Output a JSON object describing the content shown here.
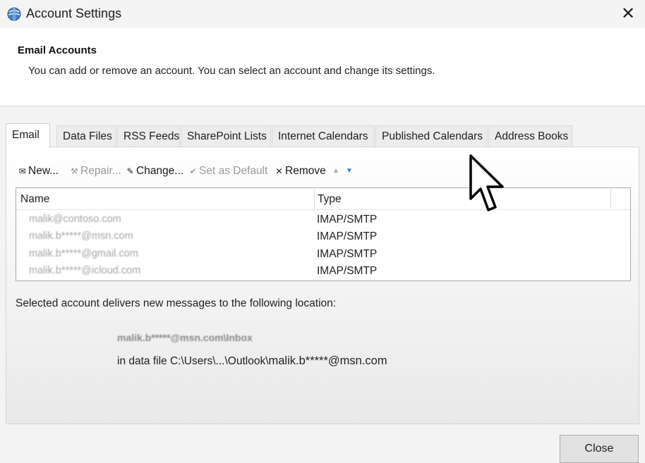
{
  "window": {
    "title": "Account Settings",
    "close_glyph": "✕"
  },
  "header": {
    "title": "Email Accounts",
    "description": "You can add or remove an account. You can select an account and change its settings."
  },
  "tabs": [
    {
      "label": "Email",
      "active": true
    },
    {
      "label": "Data Files"
    },
    {
      "label": "RSS Feeds"
    },
    {
      "label": "SharePoint Lists"
    },
    {
      "label": "Internet Calendars"
    },
    {
      "label": "Published Calendars"
    },
    {
      "label": "Address Books"
    }
  ],
  "toolbar": {
    "new_label": "New...",
    "repair_label": "Repair...",
    "change_label": "Change...",
    "set_default_label": "Set as Default",
    "remove_label": "Remove",
    "remove_glyph": "✕",
    "move_up_glyph": "▲",
    "move_down_glyph": "▼"
  },
  "account_list": {
    "columns": {
      "name": "Name",
      "type": "Type"
    },
    "rows": [
      {
        "name": "malik@contoso.com",
        "type": "IMAP/SMTP"
      },
      {
        "name": "malik.b*****@msn.com",
        "type": "IMAP/SMTP"
      },
      {
        "name": "malik.b*****@gmail.com",
        "type": "IMAP/SMTP"
      },
      {
        "name": "malik.b*****@icloud.com",
        "type": "IMAP/SMTP"
      }
    ]
  },
  "delivery": {
    "label": "Selected account delivers new messages to the following location:",
    "location": "malik.b*****@msn.com\\Inbox",
    "data_file_prefix": "in data file C:\\Users\\...\\Outlook\\",
    "data_file_name": "malik.b*****@msn.com"
  },
  "buttons": {
    "close_label": "Close"
  },
  "colors": {
    "accent_arrow": "#3b78d8",
    "disabled_text": "#9a9a9a"
  }
}
